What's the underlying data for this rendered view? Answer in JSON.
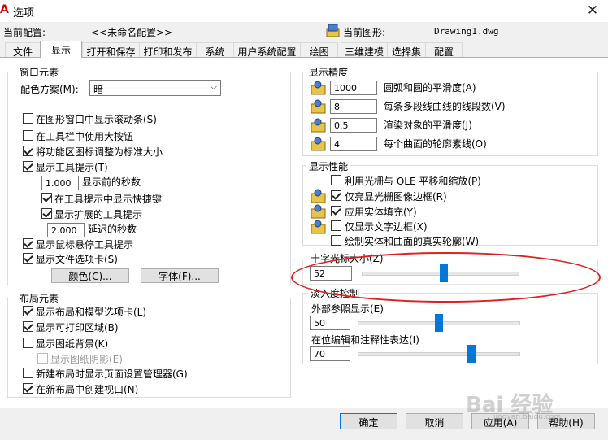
{
  "window": {
    "title": "选项"
  },
  "header": {
    "current_profile_label": "当前配置:",
    "current_profile_value": "<<未命名配置>>",
    "current_drawing_label": "当前图形:",
    "current_drawing_value": "Drawing1.dwg"
  },
  "tabs": [
    "文件",
    "显示",
    "打开和保存",
    "打印和发布",
    "系统",
    "用户系统配置",
    "绘图",
    "三维建模",
    "选择集",
    "配置"
  ],
  "active_tab": "显示",
  "window_elements": {
    "title": "窗口元素",
    "color_scheme_label": "配色方案(M):",
    "color_scheme_value": "暗",
    "options": [
      {
        "label": "在图形窗口中显示滚动条(S)",
        "checked": false
      },
      {
        "label": "在工具栏中使用大按钮",
        "checked": false
      },
      {
        "label": "将功能区图标调整为标准大小",
        "checked": true
      },
      {
        "label": "显示工具提示(T)",
        "checked": true
      }
    ],
    "delay_value": "1.000",
    "delay_label": "显示前的秒数",
    "shortcut_label": "在工具提示中显示快捷键",
    "extended_label": "显示扩展的工具提示",
    "ext_delay_value": "2.000",
    "ext_delay_label": "延迟的秒数",
    "rollover_label": "显示鼠标悬停工具提示",
    "file_tabs_label": "显示文件选项卡(S)",
    "colors_button": "颜色(C)...",
    "fonts_button": "字体(F)..."
  },
  "layout_elements": {
    "title": "布局元素",
    "options": [
      {
        "label": "显示布局和模型选项卡(L)",
        "checked": true
      },
      {
        "label": "显示可打印区域(B)",
        "checked": true
      },
      {
        "label": "显示图纸背景(K)",
        "checked": false
      },
      {
        "label": "显示图纸阴影(E)",
        "checked": false,
        "disabled": true
      },
      {
        "label": "新建布局时显示页面设置管理器(G)",
        "checked": false
      },
      {
        "label": "在新布局中创建视口(N)",
        "checked": true
      }
    ]
  },
  "display_resolution": {
    "title": "显示精度",
    "rows": [
      {
        "value": "1000",
        "label": "圆弧和圆的平滑度(A)"
      },
      {
        "value": "8",
        "label": "每条多段线曲线的线段数(V)"
      },
      {
        "value": "0.5",
        "label": "渲染对象的平滑度(J)"
      },
      {
        "value": "4",
        "label": "每个曲面的轮廓素线(O)"
      }
    ]
  },
  "display_performance": {
    "title": "显示性能",
    "options": [
      {
        "label": "利用光栅与 OLE 平移和缩放(P)",
        "checked": false
      },
      {
        "label": "仅亮显光栅图像边框(R)",
        "checked": true
      },
      {
        "label": "应用实体填充(Y)",
        "checked": true
      },
      {
        "label": "仅显示文字边框(X)",
        "checked": false
      },
      {
        "label": "绘制实体和曲面的真实轮廓(W)",
        "checked": false
      }
    ]
  },
  "crosshair": {
    "title": "十字光标大小(Z)",
    "value": "52",
    "fraction": 0.52
  },
  "fade": {
    "title": "淡入度控制",
    "xref_label": "外部参照显示(E)",
    "xref_value": "50",
    "xref_fraction": 0.5,
    "inplace_label": "在位编辑和注释性表达(I)",
    "inplace_value": "70",
    "inplace_fraction": 0.7
  },
  "buttons": {
    "ok": "确定",
    "cancel": "取消",
    "apply": "应用(A)",
    "help": "帮助(H)"
  },
  "watermark": {
    "text": "Bai 经验",
    "sub": "jingyan.baidu.com"
  }
}
